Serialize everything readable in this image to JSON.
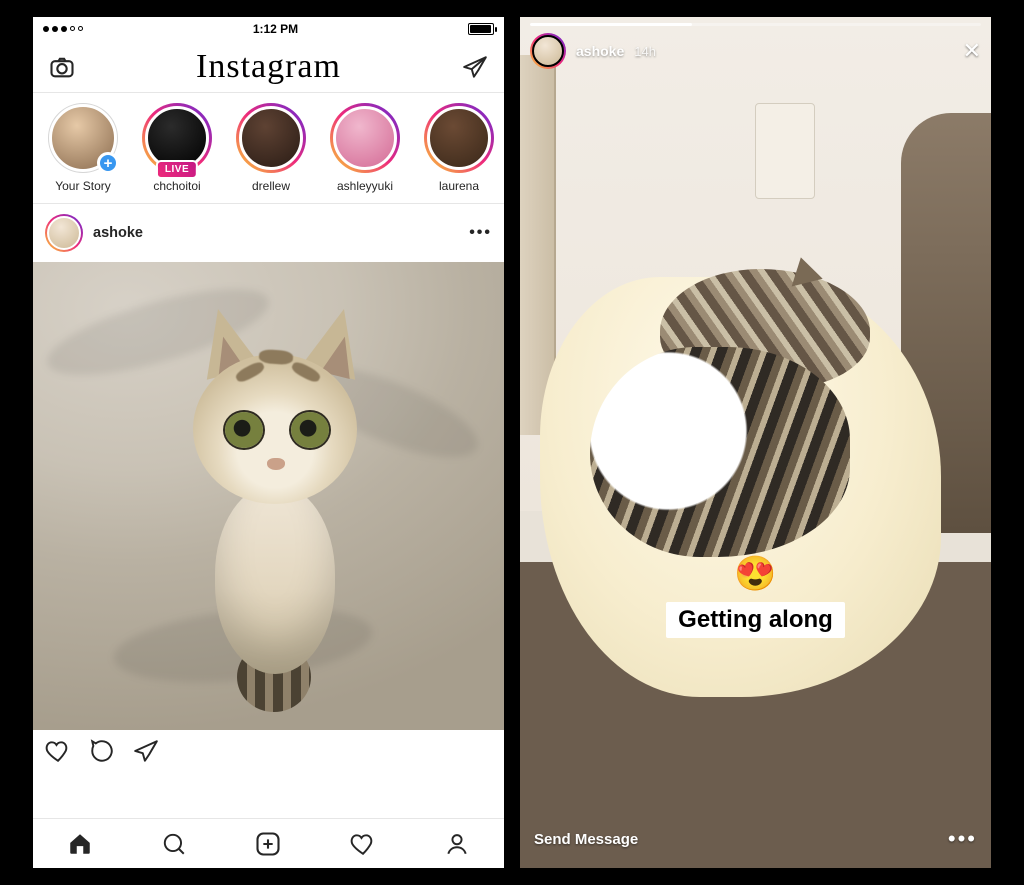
{
  "statusbar": {
    "time": "1:12 PM"
  },
  "header": {
    "brand": "Instagram"
  },
  "stories": [
    {
      "label": "Your Story",
      "live": false,
      "own": true
    },
    {
      "label": "chchoitoi",
      "live": true,
      "own": false
    },
    {
      "label": "drellew",
      "live": false,
      "own": false
    },
    {
      "label": "ashleyyuki",
      "live": false,
      "own": false
    },
    {
      "label": "laurena",
      "live": false,
      "own": false
    }
  ],
  "live_badge": "LIVE",
  "post": {
    "username": "ashoke"
  },
  "storyview": {
    "username": "ashoke",
    "timeago": "14h",
    "emoji": "😍",
    "caption": "Getting along",
    "send_placeholder": "Send Message"
  }
}
